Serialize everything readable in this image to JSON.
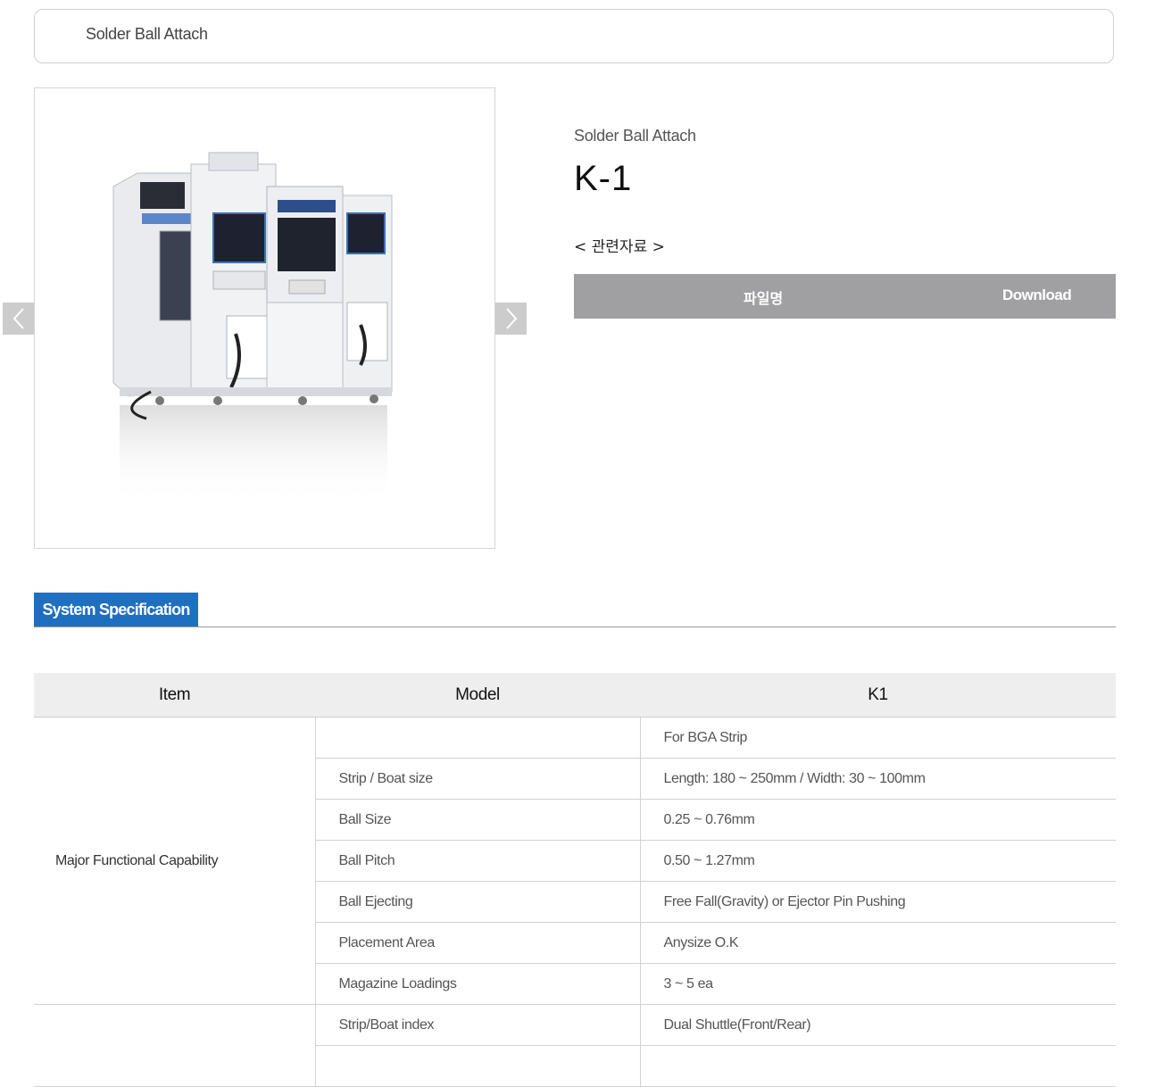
{
  "breadcrumb": {
    "label": "Solder Ball Attach"
  },
  "product": {
    "category": "Solder Ball Attach",
    "model": "K-1",
    "related_label": "< 관련자료 >"
  },
  "file_bar": {
    "filename_header": "파일명",
    "download_header": "Download"
  },
  "spec_tab": {
    "label": "System Specification"
  },
  "spec_table": {
    "headers": {
      "item": "Item",
      "model": "Model",
      "value": "K1"
    },
    "group1": {
      "item": "Major Functional Capability",
      "rows": [
        {
          "label": "",
          "value": "For BGA Strip"
        },
        {
          "label": "Strip / Boat size",
          "value": "Length: 180 ~ 250mm / Width: 30 ~ 100mm"
        },
        {
          "label": "Ball Size",
          "value": "0.25 ~ 0.76mm"
        },
        {
          "label": "Ball Pitch",
          "value": "0.50 ~ 1.27mm"
        },
        {
          "label": "Ball Ejecting",
          "value": "Free Fall(Gravity) or Ejector Pin Pushing"
        },
        {
          "label": "Placement Area",
          "value": "Anysize O.K"
        },
        {
          "label": "Magazine Loadings",
          "value": "3 ~ 5 ea"
        }
      ]
    },
    "group2": {
      "item": "",
      "rows": [
        {
          "label": "Strip/Boat index",
          "value": "Dual Shuttle(Front/Rear)"
        },
        {
          "label": "",
          "value": ""
        }
      ]
    }
  },
  "icons": {
    "prev": "chevron-left-icon",
    "next": "chevron-right-icon"
  }
}
